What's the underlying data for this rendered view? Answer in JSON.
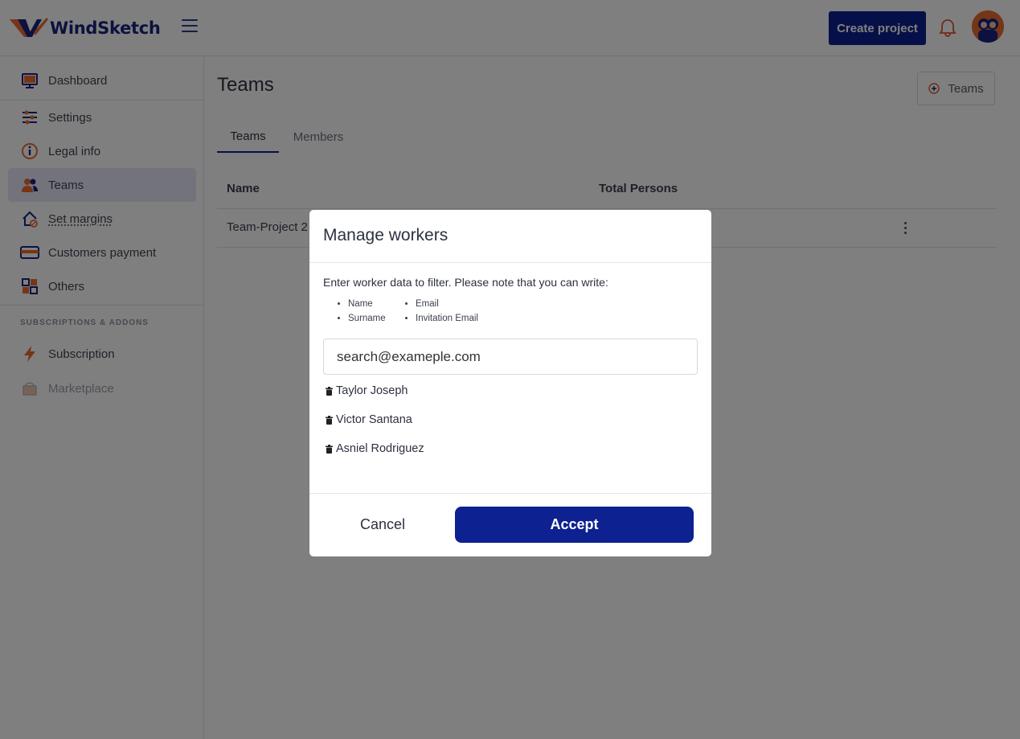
{
  "header": {
    "app_name": "WindSketch",
    "create_project_label": "Create project",
    "brand_color": "#0d2191",
    "accent_color": "#e86c2e"
  },
  "sidebar": {
    "items": [
      {
        "label": "Dashboard",
        "icon": "monitor-icon"
      },
      {
        "label": "Settings",
        "icon": "sliders-icon"
      },
      {
        "label": "Legal info",
        "icon": "info-icon"
      },
      {
        "label": "Teams",
        "icon": "team-icon",
        "active": true
      },
      {
        "label": "Set margins",
        "icon": "home-percent-icon"
      },
      {
        "label": "Customers payment",
        "icon": "credit-card-icon"
      },
      {
        "label": "Others",
        "icon": "grid-icon"
      }
    ],
    "section_title": "SUBSCRIPTIONS & ADDONS",
    "addon_items": [
      {
        "label": "Subscription",
        "icon": "lightning-icon"
      },
      {
        "label": "Marketplace",
        "icon": "store-icon",
        "disabled": true
      }
    ]
  },
  "main": {
    "title": "Teams",
    "add_team_label": "Teams",
    "tabs": [
      {
        "label": "Teams",
        "active": true
      },
      {
        "label": "Members",
        "active": false
      }
    ],
    "table": {
      "columns": [
        "Name",
        "Total Persons"
      ],
      "rows": [
        {
          "name": "Team-Project 2"
        }
      ]
    }
  },
  "modal": {
    "title": "Manage workers",
    "description": "Enter worker data to filter. Please note that you can write:",
    "hints_col1": [
      "Name",
      "Surname"
    ],
    "hints_col2": [
      "Email",
      "Invitation Email"
    ],
    "search_value": "search@exameple.com",
    "workers": [
      "Taylor Joseph",
      "Victor Santana",
      "Asniel Rodriguez"
    ],
    "cancel_label": "Cancel",
    "accept_label": "Accept"
  }
}
